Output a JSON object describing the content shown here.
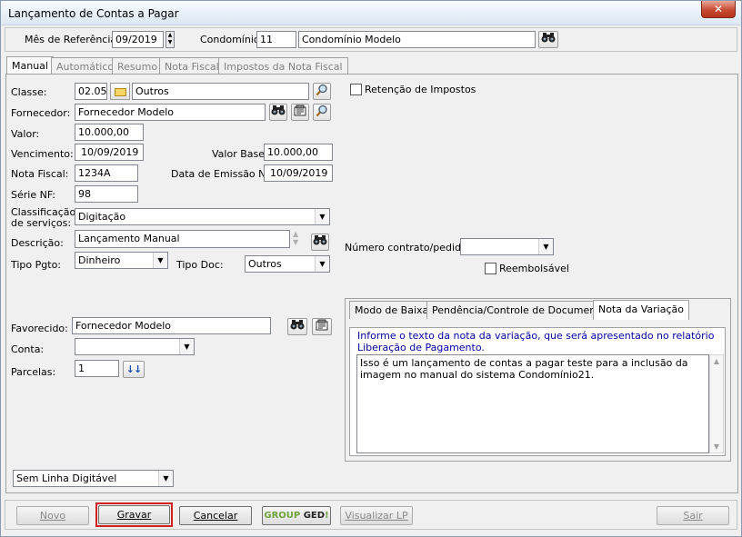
{
  "window": {
    "title": "Lançamento de Contas a Pagar",
    "close_label": "✕"
  },
  "top": {
    "mes_label": "Mês de Referência:",
    "mes_value": "09/2019",
    "condominio_label": "Condomínio:",
    "condominio_code": "11",
    "condominio_name": "Condomínio Modelo"
  },
  "tabs": [
    {
      "label": "Manual"
    },
    {
      "label": "Automático"
    },
    {
      "label": "Resumo"
    },
    {
      "label": "Nota Fiscal"
    },
    {
      "label": "Impostos da Nota Fiscal"
    }
  ],
  "form": {
    "classe_label": "Classe:",
    "classe_code": "02.05",
    "classe_name": "Outros",
    "fornecedor_label": "Fornecedor:",
    "fornecedor_value": "Fornecedor Modelo",
    "valor_label": "Valor:",
    "valor_value": "10.000,00",
    "vencimento_label": "Vencimento:",
    "vencimento_value": "10/09/2019",
    "valor_base_label": "Valor Base:",
    "valor_base_value": "10.000,00",
    "nota_fiscal_label": "Nota Fiscal:",
    "nota_fiscal_value": "1234A",
    "data_emissao_label": "Data de Emissão NF:",
    "data_emissao_value": "10/09/2019",
    "serie_label": "Série NF:",
    "serie_value": "98",
    "classificacao_label_1": "Classificação",
    "classificacao_label_2": "de serviços:",
    "classificacao_value": "Digitação",
    "descricao_label": "Descrição:",
    "descricao_value": "Lançamento Manual",
    "tipo_pgto_label": "Tipo Pgto:",
    "tipo_pgto_value": "Dinheiro",
    "tipo_doc_label": "Tipo Doc:",
    "tipo_doc_value": "Outros",
    "retencao_label": "Retenção de Impostos",
    "contrato_label": "Número contrato/pedido:",
    "contrato_value": "",
    "reembolsavel_label": "Reembolsável",
    "favorecido_label": "Favorecido:",
    "favorecido_value": "Fornecedor Modelo",
    "conta_label": "Conta:",
    "conta_value": "",
    "parcelas_label": "Parcelas:",
    "parcelas_value": "1",
    "linha_digitavel_value": "Sem Linha Digitável"
  },
  "inner_tabs": [
    {
      "label": "Modo de Baixa"
    },
    {
      "label": "Pendência/Controle de Documentos"
    },
    {
      "label": "Nota da Variação"
    }
  ],
  "nota_variacao": {
    "hint": "Informe o texto da nota da variação, que será apresentado no relatório Liberação de Pagamento.",
    "text": "Isso é um lançamento de contas a pagar teste para a inclusão da imagem no manual do sistema Condomínio21."
  },
  "buttons": {
    "novo": "Novo",
    "gravar": "Gravar",
    "cancelar": "Cancelar",
    "group_ged_1": "GROUP",
    "group_ged_2": "GED",
    "group_ged_3": "!",
    "visualizar": "Visualizar LP",
    "sair": "Sair"
  },
  "icons": {
    "binoculars": "binoculars-icon",
    "search": "magnifier-icon",
    "folder": "folder-icon",
    "card": "register-card-icon",
    "double_down": "double-arrow-down-icon"
  },
  "colors": {
    "highlight": "#d02020",
    "hint_text": "#0000a0",
    "ged_green": "#6ea23a"
  }
}
